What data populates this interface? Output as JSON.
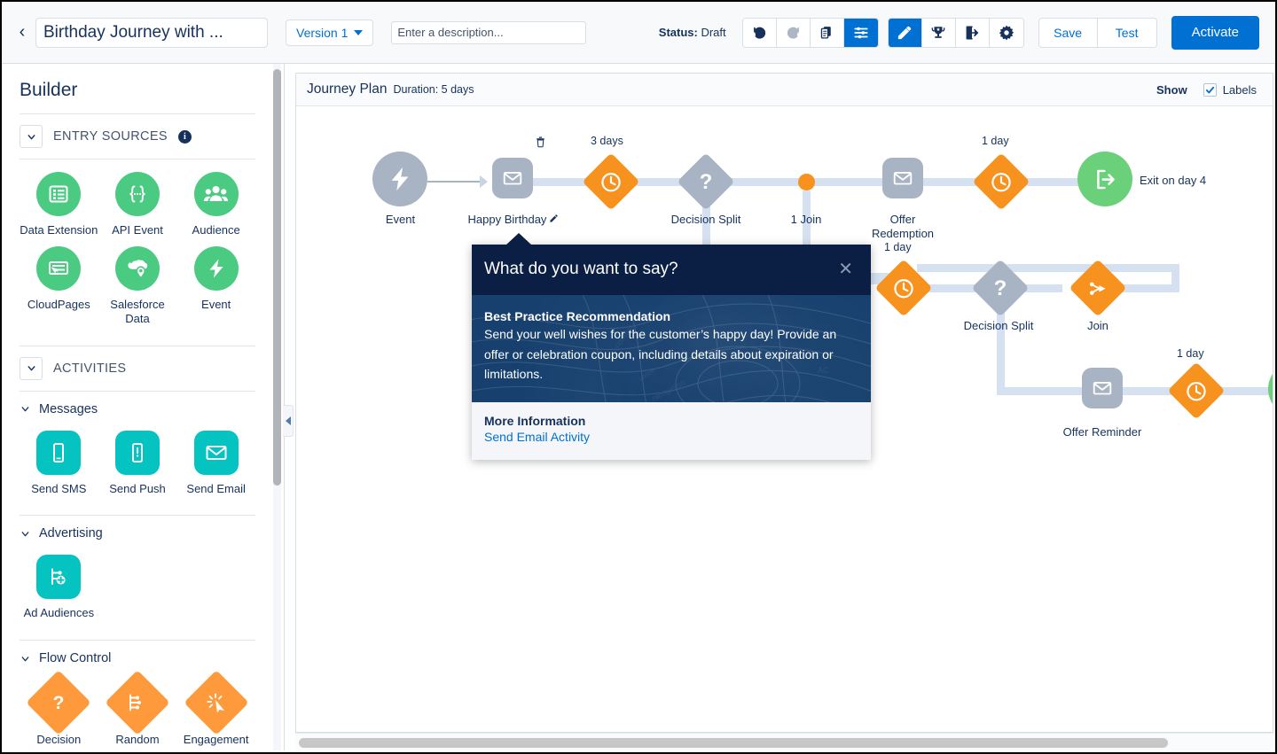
{
  "header": {
    "back_icon": "chevron-left-icon",
    "journey_name": "Birthday Journey with ...",
    "version_label": "Version 1",
    "description_placeholder": "Enter a description...",
    "status_label": "Status:",
    "status_value": "Draft",
    "tools": [
      {
        "name": "undo-icon",
        "label": "Undo",
        "state": "enabled"
      },
      {
        "name": "redo-icon",
        "label": "Redo",
        "state": "disabled"
      },
      {
        "name": "copy-icon",
        "label": "Copy",
        "state": "enabled"
      },
      {
        "name": "settings-sliders-icon",
        "label": "Journey Settings",
        "state": "active"
      },
      {
        "name": "pencil-icon",
        "label": "Edit",
        "state": "active"
      },
      {
        "name": "goal-trophy-icon",
        "label": "Goal",
        "state": "enabled"
      },
      {
        "name": "exit-icon",
        "label": "Exit Criteria",
        "state": "enabled"
      },
      {
        "name": "gear-icon",
        "label": "Settings",
        "state": "enabled"
      }
    ],
    "save_label": "Save",
    "test_label": "Test",
    "activate_label": "Activate"
  },
  "sidebar": {
    "title": "Builder",
    "entry_sources": {
      "label": "ENTRY SOURCES",
      "info_icon": "info-icon",
      "items": [
        {
          "label": "Data Extension",
          "icon": "list-icon",
          "shape": "circle",
          "color": "#4bca81"
        },
        {
          "label": "API Event",
          "icon": "braces-icon",
          "shape": "circle",
          "color": "#4bca81"
        },
        {
          "label": "Audience",
          "icon": "people-icon",
          "shape": "circle",
          "color": "#4bca81"
        },
        {
          "label": "CloudPages",
          "icon": "cloudpage-icon",
          "shape": "circle",
          "color": "#4bca81"
        },
        {
          "label": "Salesforce Data",
          "icon": "cloud-pin-icon",
          "shape": "circle",
          "color": "#4bca81"
        },
        {
          "label": "Event",
          "icon": "lightning-icon",
          "shape": "circle",
          "color": "#4bca81"
        }
      ]
    },
    "activities": {
      "label": "ACTIVITIES",
      "groups": [
        {
          "label": "Messages",
          "items": [
            {
              "label": "Send SMS",
              "icon": "phone-icon",
              "shape": "rsq",
              "color": "#04c3c1"
            },
            {
              "label": "Send Push",
              "icon": "push-alert-icon",
              "shape": "rsq",
              "color": "#04c3c1"
            },
            {
              "label": "Send Email",
              "icon": "envelope-icon",
              "shape": "rsq",
              "color": "#04c3c1"
            }
          ]
        },
        {
          "label": "Advertising",
          "items": [
            {
              "label": "Ad Audiences",
              "icon": "ad-audience-icon",
              "shape": "rsq",
              "color": "#04c3c1"
            }
          ]
        },
        {
          "label": "Flow Control",
          "items": [
            {
              "label": "Decision",
              "icon": "question-icon",
              "shape": "diamond",
              "color": "#ff9a3c"
            },
            {
              "label": "Random",
              "icon": "random-split-icon",
              "shape": "diamond",
              "color": "#ff9a3c"
            },
            {
              "label": "Engagement",
              "icon": "engagement-icon",
              "shape": "diamond",
              "color": "#ff9a3c"
            }
          ]
        }
      ]
    }
  },
  "canvas": {
    "plan_title": "Journey Plan",
    "plan_duration": "Duration: 5 days",
    "show_label": "Show",
    "labels_checkbox_label": "Labels",
    "labels_checked": true,
    "nodes": [
      {
        "id": "event",
        "label": "Event",
        "icon": "lightning-icon",
        "shape": "circle-grey"
      },
      {
        "id": "happy-birthday",
        "label": "Happy Birthday",
        "icon": "envelope-icon",
        "shape": "rsq-grey",
        "editable": true,
        "deletable": true
      },
      {
        "id": "wait-3-days",
        "label": "",
        "icon": "clock-icon",
        "shape": "diamond-orange",
        "time": "3 days"
      },
      {
        "id": "decision-split-1",
        "label": "Decision Split",
        "icon": "question-icon",
        "shape": "diamond-grey"
      },
      {
        "id": "join-1",
        "label": "1 Join",
        "icon": "dot-icon",
        "shape": "dot-orange"
      },
      {
        "id": "offer-redemption",
        "label": "Offer Redemption",
        "icon": "envelope-icon",
        "shape": "rsq-grey"
      },
      {
        "id": "wait-1-day-a",
        "label": "",
        "icon": "clock-icon",
        "shape": "diamond-orange",
        "time": "1 day"
      },
      {
        "id": "exit-day-4",
        "label": "Exit on day 4",
        "icon": "exit-icon",
        "shape": "circle-green"
      },
      {
        "id": "wait-1-day-b",
        "label": "",
        "icon": "clock-icon",
        "shape": "diamond-orange",
        "time": "1 day"
      },
      {
        "id": "decision-split-2",
        "label": "Decision Split",
        "icon": "question-icon",
        "shape": "diamond-grey"
      },
      {
        "id": "join-2",
        "label": "Join",
        "icon": "join-icon",
        "shape": "diamond-orange"
      },
      {
        "id": "offer-reminder",
        "label": "Offer Reminder",
        "icon": "envelope-icon",
        "shape": "rsq-grey"
      },
      {
        "id": "wait-1-day-c",
        "label": "",
        "icon": "clock-icon",
        "shape": "diamond-orange",
        "time": "1 day"
      },
      {
        "id": "exit-2",
        "label": "",
        "icon": "exit-icon",
        "shape": "circle-green"
      }
    ],
    "time_labels": [
      "3 days",
      "1 day",
      "1 day",
      "1 day"
    ]
  },
  "popover": {
    "title": "What do you want to say?",
    "close_icon": "close-icon",
    "body_title": "Best Practice Recommendation",
    "body_text": "Send your well wishes for the customer’s happy day! Provide an offer or celebration coupon, including details about expiration or limitations.",
    "footer_title": "More Information",
    "footer_link": "Send Email Activity"
  }
}
